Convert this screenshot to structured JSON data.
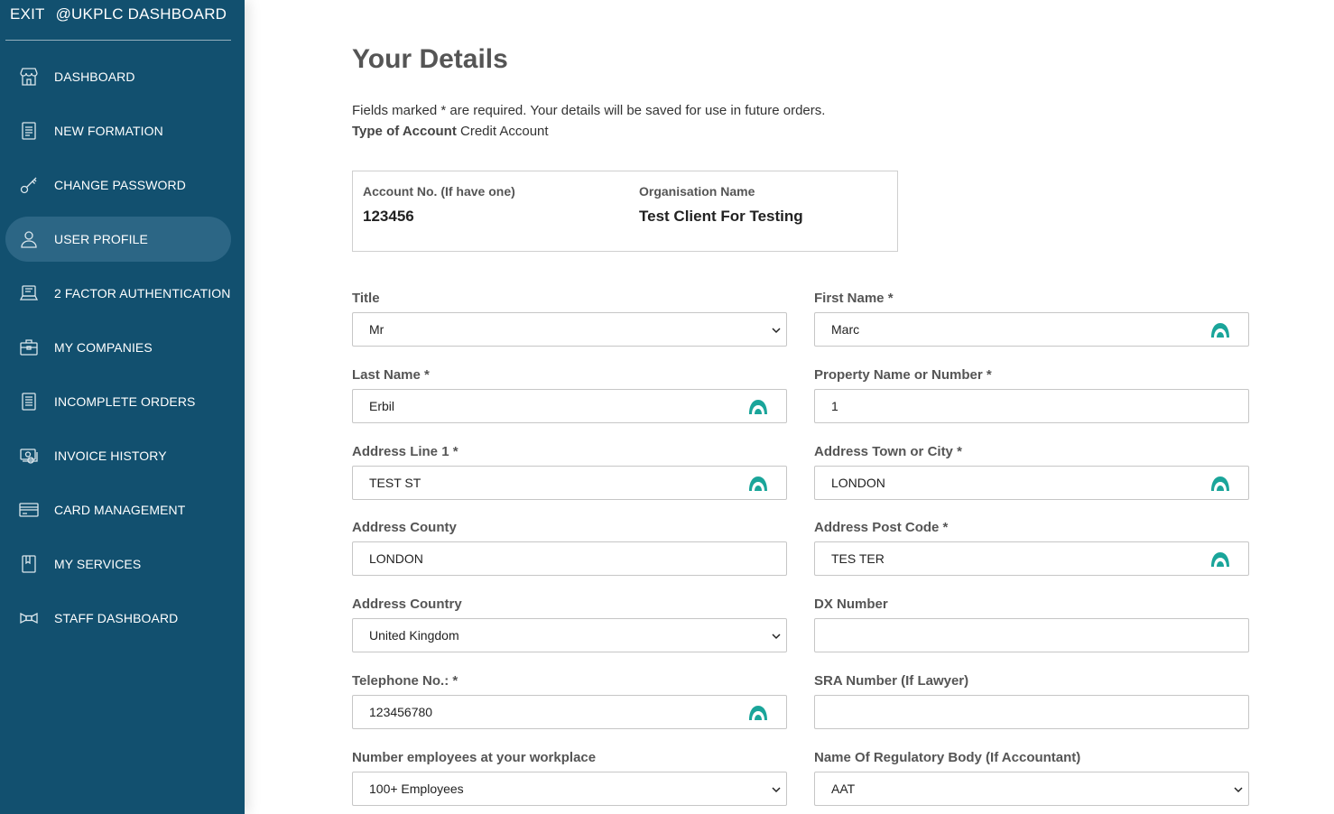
{
  "sidebar": {
    "exit_label": "EXIT",
    "brand": "@UKPLC DASHBOARD",
    "items": [
      {
        "label": "DASHBOARD",
        "icon": "store-icon"
      },
      {
        "label": "NEW FORMATION",
        "icon": "document-icon"
      },
      {
        "label": "CHANGE PASSWORD",
        "icon": "key-icon"
      },
      {
        "label": "USER PROFILE",
        "icon": "user-icon",
        "active": true
      },
      {
        "label": "2 FACTOR AUTHENTICATION",
        "icon": "laptop-icon"
      },
      {
        "label": "MY COMPANIES",
        "icon": "briefcase-icon"
      },
      {
        "label": "INCOMPLETE ORDERS",
        "icon": "list-icon"
      },
      {
        "label": "INVOICE HISTORY",
        "icon": "money-icon"
      },
      {
        "label": "CARD MANAGEMENT",
        "icon": "credit-card-icon"
      },
      {
        "label": "MY SERVICES",
        "icon": "book-icon"
      },
      {
        "label": "STAFF DASHBOARD",
        "icon": "ribbon-icon"
      }
    ]
  },
  "page": {
    "title": "Your Details",
    "intro": "Fields marked * are required. Your details will be saved for use in future orders.",
    "account_type_label": "Type of Account",
    "account_type_value": "Credit Account"
  },
  "account": {
    "number_label": "Account No. (If have one)",
    "number_value": "123456",
    "org_label": "Organisation Name",
    "org_value": "Test Client For Testing"
  },
  "form": {
    "title": {
      "label": "Title",
      "value": "Mr"
    },
    "first_name": {
      "label": "First Name *",
      "value": "Marc"
    },
    "last_name": {
      "label": "Last Name *",
      "value": "Erbil"
    },
    "property": {
      "label": "Property Name or Number *",
      "value": "1"
    },
    "address1": {
      "label": "Address Line 1 *",
      "value": "TEST ST"
    },
    "town": {
      "label": "Address Town or City *",
      "value": "LONDON"
    },
    "county": {
      "label": "Address County",
      "value": "LONDON"
    },
    "postcode": {
      "label": "Address Post Code *",
      "value": "TES TER"
    },
    "country": {
      "label": "Address Country",
      "value": "United Kingdom"
    },
    "dx": {
      "label": "DX Number",
      "value": ""
    },
    "telephone": {
      "label": "Telephone No.: *",
      "value": "123456780"
    },
    "sra": {
      "label": "SRA Number (If Lawyer)",
      "value": ""
    },
    "employees": {
      "label": "Number employees at your workplace",
      "value": "100+ Employees"
    },
    "regulatory": {
      "label": "Name Of Regulatory Body (If Accountant)",
      "value": "AAT"
    }
  },
  "colors": {
    "sidebar_bg": "#12506f",
    "sidebar_active": "#2c6685",
    "autofill_icon": "#1aa59a"
  }
}
